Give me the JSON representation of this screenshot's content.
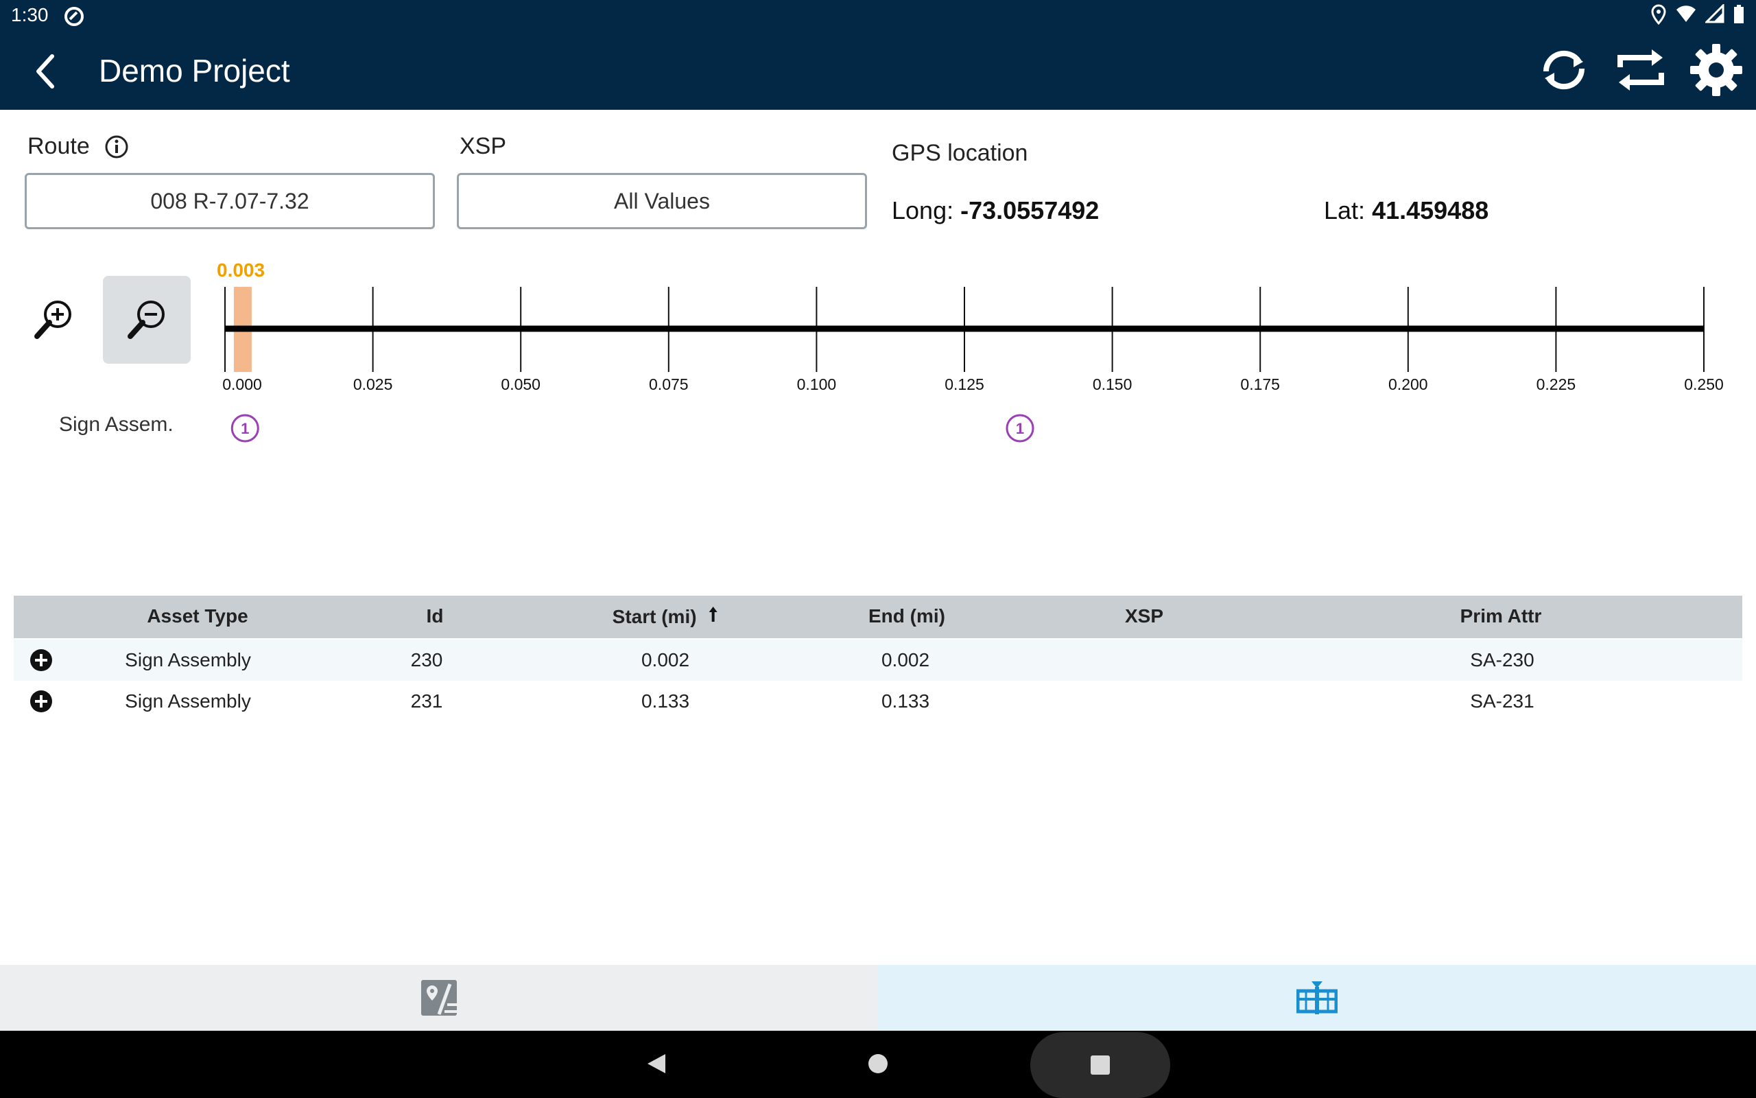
{
  "status_bar": {
    "time": "1:30"
  },
  "app_bar": {
    "title": "Demo Project"
  },
  "filters": {
    "route_label": "Route",
    "route_value": "008  R-7.07-7.32",
    "xsp_label": "XSP",
    "xsp_value": "All Values"
  },
  "gps": {
    "title": "GPS location",
    "long_label": "Long:",
    "long_value": "-73.0557492",
    "lat_label": "Lat:",
    "lat_value": "41.459488"
  },
  "timeline": {
    "marker_value": "0.003",
    "ticks": [
      "0.000",
      "0.025",
      "0.050",
      "0.075",
      "0.100",
      "0.125",
      "0.150",
      "0.175",
      "0.200",
      "0.225",
      "0.250"
    ],
    "track_label": "Sign Assem.",
    "track_points": [
      {
        "position_mi": 0.002,
        "count": "1"
      },
      {
        "position_mi": 0.133,
        "count": "1"
      }
    ]
  },
  "table": {
    "columns": {
      "asset_type": "Asset Type",
      "id": "Id",
      "start": "Start (mi)",
      "end": "End (mi)",
      "xsp": "XSP",
      "prim_attr": "Prim Attr"
    },
    "rows": [
      {
        "asset_type": "Sign Assembly",
        "id": "230",
        "start": "0.002",
        "end": "0.002",
        "xsp": "",
        "prim_attr": "SA-230"
      },
      {
        "asset_type": "Sign Assembly",
        "id": "231",
        "start": "0.133",
        "end": "0.133",
        "xsp": "",
        "prim_attr": "SA-231"
      }
    ]
  },
  "colors": {
    "app_bar": "#022846",
    "marker": "#f5b88c",
    "marker_text": "#f0a000",
    "track_point": "#9b3fb5",
    "active_tab": "#1a8fd0",
    "inactive_tab": "#7f868c"
  },
  "icons": {
    "back": "chevron-left-icon",
    "sync": "sync-icon",
    "transfer": "transfer-icon",
    "settings": "gear-icon",
    "zoom_in": "zoom-in-icon",
    "zoom_out": "zoom-out-icon",
    "info": "info-icon",
    "expand_row": "plus-circle-icon",
    "map_tab": "map-pin-icon",
    "timeline_tab": "timeline-icon"
  }
}
